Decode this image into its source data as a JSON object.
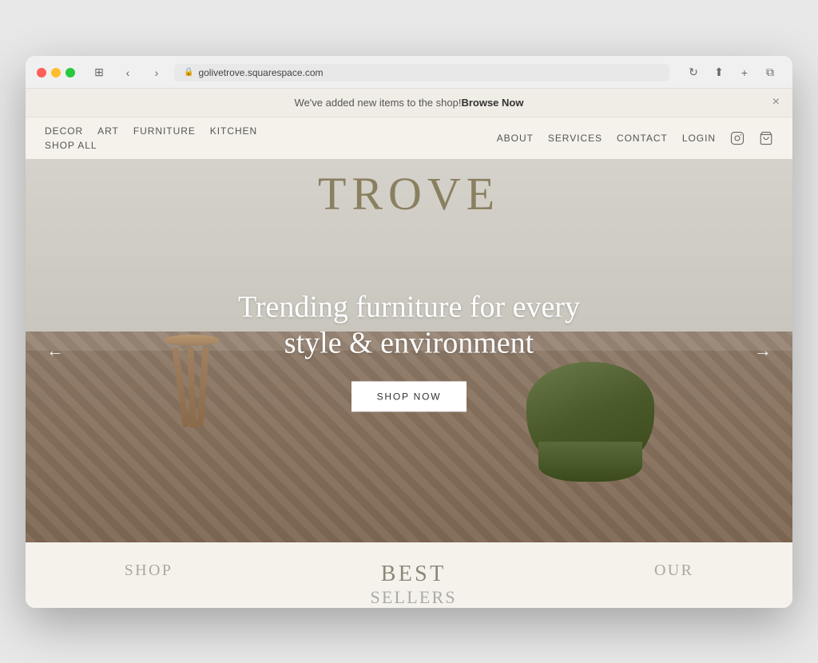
{
  "browser": {
    "url": "golivetrove.squarespace.com",
    "back_title": "Back",
    "forward_title": "Forward"
  },
  "announcement": {
    "text": "We've added new items to the shop! ",
    "link_text": "Browse Now",
    "close_label": "×"
  },
  "nav": {
    "left_row1": [
      "DECOR",
      "ART",
      "FURNITURE",
      "KITCHEN"
    ],
    "left_row2": [
      "SHOP ALL"
    ],
    "right_items": [
      "ABOUT",
      "SERVICES",
      "CONTACT",
      "LOGIN"
    ],
    "instagram_label": "Instagram",
    "cart_label": "Cart"
  },
  "hero": {
    "brand": "TROVE",
    "headline": "Trending furniture for every style & environment",
    "cta_label": "SHOP NOW",
    "prev_label": "←",
    "next_label": "→"
  },
  "below_hero": {
    "left_label": "SHOP",
    "center_label": "BEST\nSELLERS",
    "right_label": "OUR"
  }
}
